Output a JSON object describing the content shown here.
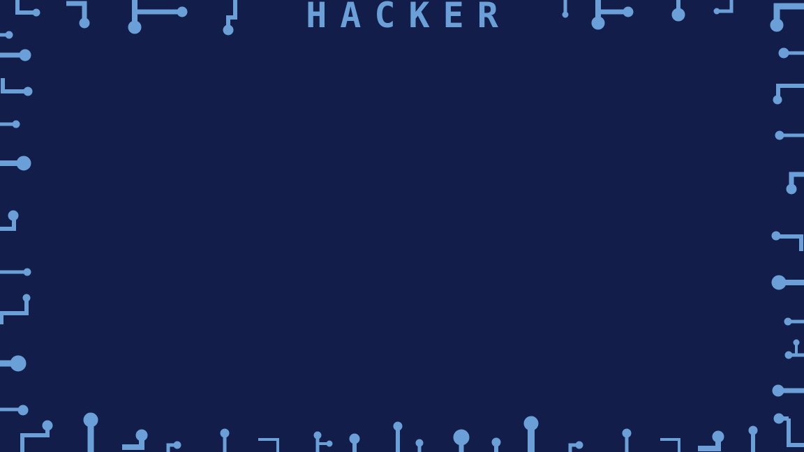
{
  "title": "HACKER",
  "colors": {
    "background": "#121e49",
    "accent": "#6a9fd8"
  },
  "decoration": "circuit-trace-border"
}
